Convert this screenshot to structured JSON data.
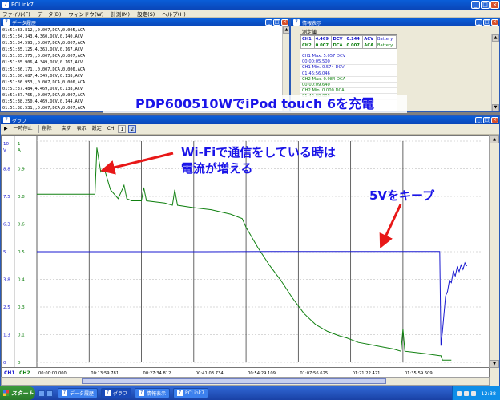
{
  "app": {
    "title": "PCLink7"
  },
  "menu": [
    "ファイル(F)",
    "データ(D)",
    "ウィンドウ(W)",
    "計測(M)",
    "設定(S)",
    "ヘルプ(H)"
  ],
  "datawin": {
    "title": "データ履歴",
    "rows": [
      "01:51:33.812,,0.007,DCA,0.005,ACA",
      "01:51:34.343,4.360,DCV,0.140,ACV",
      "01:51:34.593,,0.007,DCA,0.007,ACA",
      "01:51:35.125,4.363,DCV,0.167,ACV",
      "01:51:35.375,,0.007,DCA,0.007,ACA",
      "01:51:35.906,4.349,DCV,0.167,ACV",
      "01:51:36.171,,0.007,DCA,0.006,ACA",
      "01:51:36.687,4.349,DCV,0.138,ACV",
      "01:51:36.953,,0.007,DCA,0.006,ACA",
      "01:51:37.484,4.469,DCV,0.138,ACV",
      "01:51:37.765,,0.007,DCA,0.007,ACA",
      "01:51:38.250,4.469,DCV,0.144,ACV",
      "01:51:38.531,,0.007,DCA,0.007,ACA"
    ]
  },
  "infowin": {
    "title": "情報表示",
    "tab": "測定値",
    "table": [
      [
        "CH1",
        "4.469",
        "DCV",
        "0.144",
        "ACV",
        "Battery"
      ],
      [
        "CH2",
        "0.007",
        "DCA",
        "0.007",
        "ACA",
        "Battery"
      ]
    ],
    "stats": [
      {
        "text": "CH1 Max. 5.057 DCV",
        "ch": "b"
      },
      {
        "text": "00:00:05.500",
        "ch": "b"
      },
      {
        "text": "CH1 Min. 0.574 DCV",
        "ch": "b"
      },
      {
        "text": "01:46:56.046",
        "ch": "b"
      },
      {
        "text": "CH2 Max. 0.984 DCA",
        "ch": "g"
      },
      {
        "text": "00:00:09.640",
        "ch": "g"
      },
      {
        "text": "CH2 Min. 0.000 DCA",
        "ch": "g"
      },
      {
        "text": "01:40:00.000",
        "ch": "g"
      }
    ]
  },
  "graphwin": {
    "title": "グラフ",
    "toolbar": {
      "pause": "一時停止",
      "delete": "削除",
      "back": "戻す",
      "display": "表示",
      "settings": "設定",
      "ch_label": "CH",
      "ch1": "1",
      "ch2": "2"
    }
  },
  "annotations": {
    "title": "PDP600510WでiPod touch 6を充電",
    "wifi_line1": "Wi-Fiで通信をしている時は",
    "wifi_line2": "電流が増える",
    "keep5v": "5Vをキープ"
  },
  "taskbar": {
    "start": "スタート",
    "items": [
      "データ履歴",
      "グラフ",
      "情報表示",
      "PCLink7"
    ],
    "clock": "12:38"
  },
  "colors": {
    "ch1": "#1a1ad0",
    "ch2": "#108010",
    "annotation": "#1a14e8",
    "arrow": "#e81818"
  },
  "chart_data": {
    "type": "line",
    "left_axis": {
      "ticks": [
        "10",
        "8.8",
        "7.5",
        "6.3",
        "5",
        "3.8",
        "2.5",
        "1.3",
        "0"
      ],
      "unit": "V",
      "ylim": [
        0,
        10
      ]
    },
    "right_axis": {
      "ticks": [
        "1",
        "0.9",
        "0.8",
        "0.6",
        "0.5",
        "0.4",
        "0.3",
        "0.1",
        "0"
      ],
      "unit": "A",
      "ylim": [
        0,
        1
      ]
    },
    "x_ticks": [
      "00:00:00.000",
      "00:13:59.781",
      "00:27:34.812",
      "00:41:03.734",
      "00:54:29.109",
      "01:07:56.625",
      "01:21:22.421",
      "01:35:59.609"
    ],
    "bottom_labels": {
      "ch1": "CH1",
      "ch2": "CH2"
    },
    "x_minutes_max": 115,
    "series": [
      {
        "axis": "right",
        "points": [
          [
            0,
            0.76
          ],
          [
            13,
            0.76
          ],
          [
            15,
            0.76
          ],
          [
            15.5,
            0.97
          ],
          [
            16.5,
            0.86
          ],
          [
            17.5,
            0.87
          ],
          [
            19,
            0.78
          ],
          [
            21,
            0.74
          ],
          [
            22.5,
            0.8
          ],
          [
            23.2,
            0.74
          ],
          [
            24.5,
            0.73
          ],
          [
            27,
            0.73
          ],
          [
            27.6,
            0.79
          ],
          [
            28.3,
            0.73
          ],
          [
            33,
            0.72
          ],
          [
            35,
            0.71
          ],
          [
            35.6,
            0.78
          ],
          [
            36.3,
            0.71
          ],
          [
            40,
            0.7
          ],
          [
            45,
            0.69
          ],
          [
            50,
            0.67
          ],
          [
            53,
            0.65
          ],
          [
            54,
            0.61
          ],
          [
            57,
            0.52
          ],
          [
            60,
            0.44
          ],
          [
            63,
            0.37
          ],
          [
            66,
            0.29
          ],
          [
            69,
            0.22
          ],
          [
            72,
            0.17
          ],
          [
            75,
            0.14
          ],
          [
            78,
            0.12
          ],
          [
            80,
            0.11
          ],
          [
            83,
            0.09
          ],
          [
            86,
            0.08
          ],
          [
            89,
            0.07
          ],
          [
            92,
            0.06
          ],
          [
            94,
            0.05
          ],
          [
            94.5,
            0.15
          ],
          [
            95,
            0.05
          ],
          [
            100,
            0.04
          ],
          [
            104,
            0.03
          ],
          [
            104.3,
            0.03
          ],
          [
            104.7,
            0.01
          ],
          [
            107,
            0.01
          ]
        ]
      },
      {
        "axis": "left",
        "points": [
          [
            0,
            5.0
          ],
          [
            20,
            5.0
          ],
          [
            40,
            5.0
          ],
          [
            60,
            5.01
          ],
          [
            80,
            5.01
          ],
          [
            104,
            5.01
          ],
          [
            104.3,
            0.75
          ],
          [
            104.7,
            1.4
          ],
          [
            105.5,
            3.0
          ],
          [
            106,
            3.2
          ],
          [
            106.5,
            3.7
          ],
          [
            107,
            3.6
          ],
          [
            107.5,
            4.1
          ],
          [
            108,
            3.9
          ],
          [
            108.5,
            4.3
          ],
          [
            109,
            4.1
          ],
          [
            109.5,
            4.4
          ],
          [
            110,
            4.2
          ],
          [
            110.5,
            4.5
          ],
          [
            111,
            4.35
          ]
        ]
      }
    ]
  }
}
